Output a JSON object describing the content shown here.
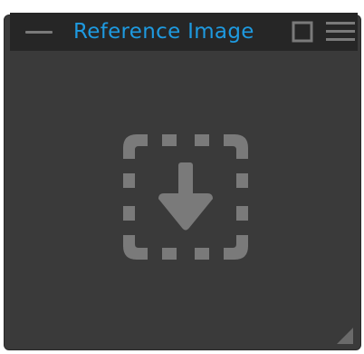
{
  "panel": {
    "title": "Reference Image"
  },
  "icons": {
    "collapse": "minus-icon",
    "float": "square-window-icon",
    "menu": "hamburger-menu-icon",
    "dropzone": "download-arrow-icon",
    "resize": "resize-grip-icon"
  },
  "colors": {
    "title_accent": "#1e9ae0",
    "panel_bg": "#3a3a3a",
    "header_bg": "#262626",
    "icon_gray": "#7a7a7a"
  }
}
